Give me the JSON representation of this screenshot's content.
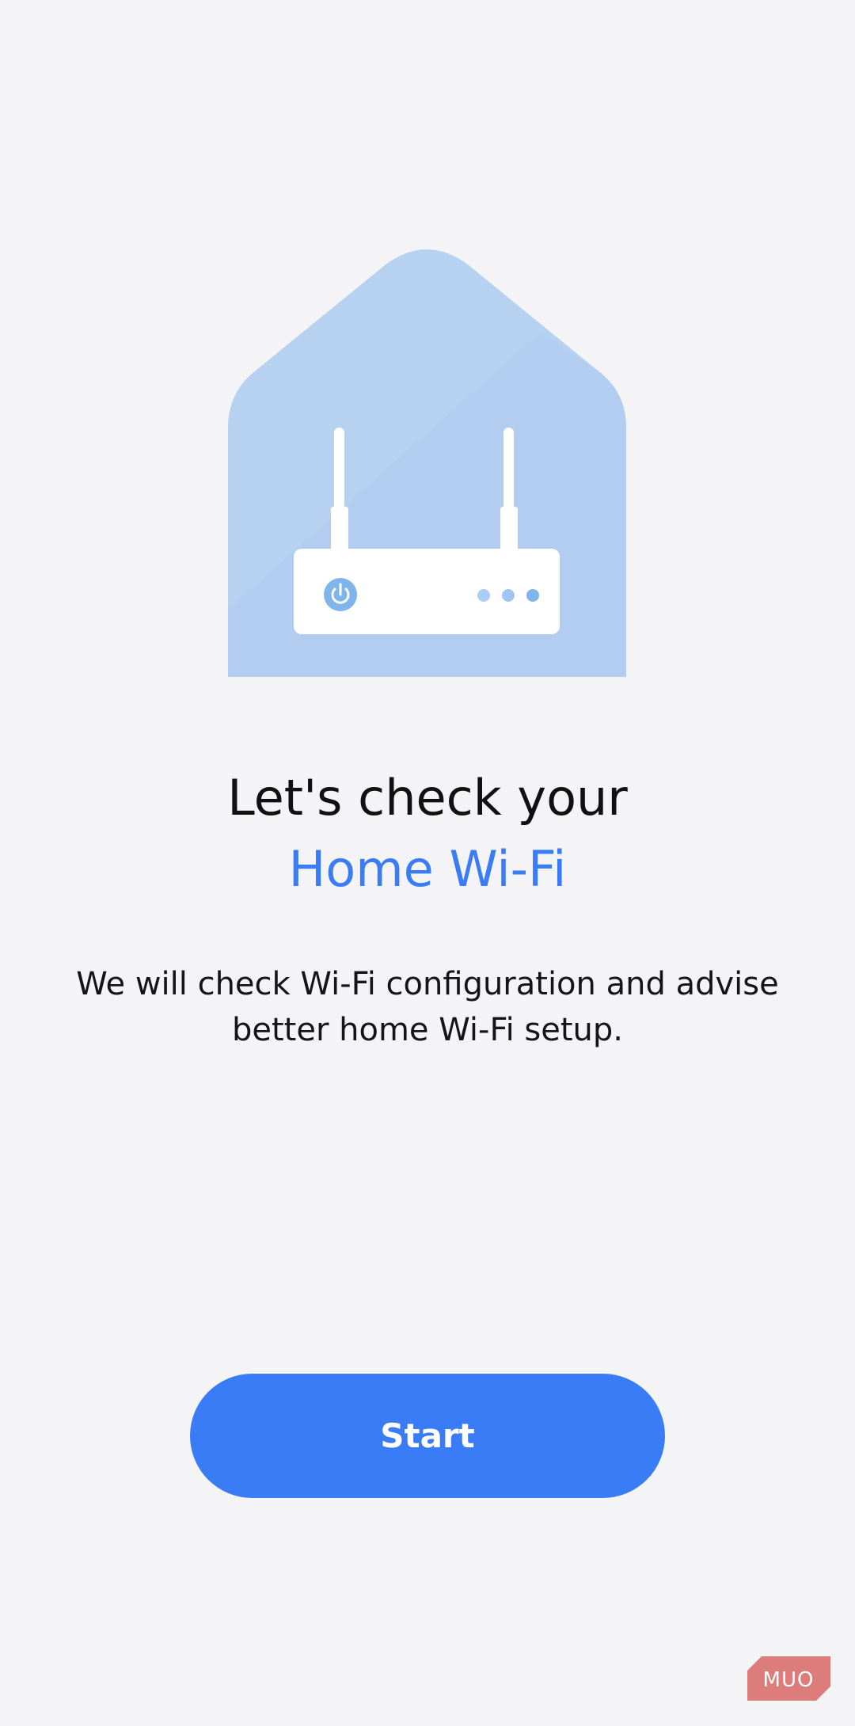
{
  "illustration": {
    "icon": "house-router-icon",
    "house_color": "#b7d1f1",
    "router_color": "#ffffff",
    "accent_color": "#7fb5ec"
  },
  "title": {
    "line1": "Let's check your",
    "line2": "Home Wi-Fi",
    "accent_color": "#3a7cf6"
  },
  "description": "We will check Wi-Fi configuration and advise better home Wi-Fi setup.",
  "start_button": {
    "label": "Start",
    "color": "#3a7cf6"
  },
  "watermark": {
    "text": "MUO",
    "color": "#d9706e"
  }
}
